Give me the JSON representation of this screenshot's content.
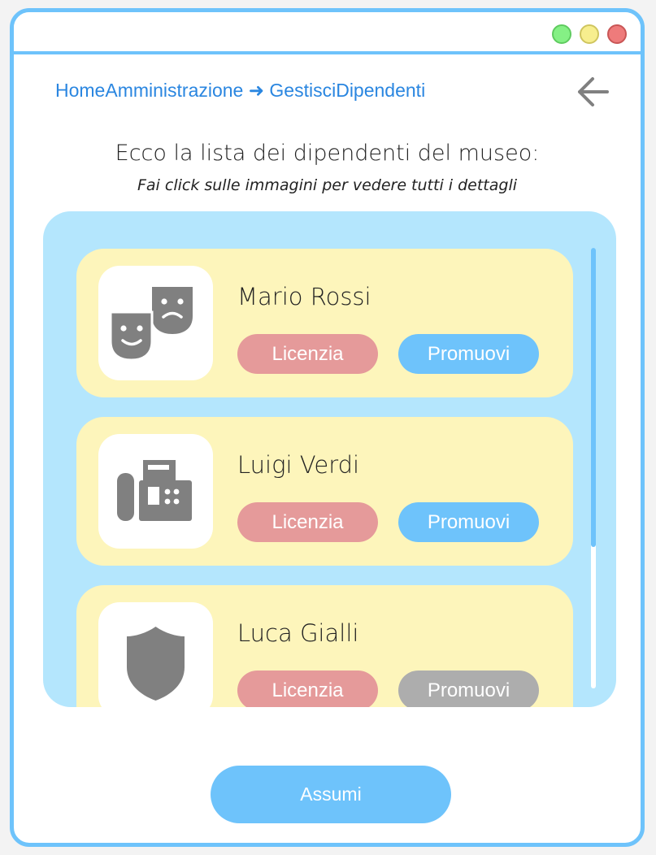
{
  "window": {
    "controls": [
      "maximize",
      "minimize",
      "close"
    ]
  },
  "breadcrumb": {
    "home": "HomeAmministrazione",
    "separator": "➜",
    "current": "GestisciDipendenti"
  },
  "back_icon": "arrow-left-icon",
  "heading": "Ecco la lista dei dipendenti del museo:",
  "subheading": "Fai click sulle immagini per vedere tutti i dettagli",
  "employees": [
    {
      "name": "Mario Rossi",
      "icon": "theater-masks-icon",
      "fire_label": "Licenzia",
      "promote_label": "Promuovi",
      "promote_enabled": true
    },
    {
      "name": "Luigi Verdi",
      "icon": "fax-machine-icon",
      "fire_label": "Licenzia",
      "promote_label": "Promuovi",
      "promote_enabled": true
    },
    {
      "name": "Luca Gialli",
      "icon": "shield-icon",
      "fire_label": "Licenzia",
      "promote_label": "Promuovi",
      "promote_enabled": false
    }
  ],
  "hire_label": "Assumi",
  "colors": {
    "accent": "#6ec3fb",
    "panel": "#b4e6fd",
    "card": "#fdf5bb",
    "fire": "#e59a9a",
    "disabled": "#adadad",
    "link": "#2a86e0",
    "icon": "#808080"
  }
}
